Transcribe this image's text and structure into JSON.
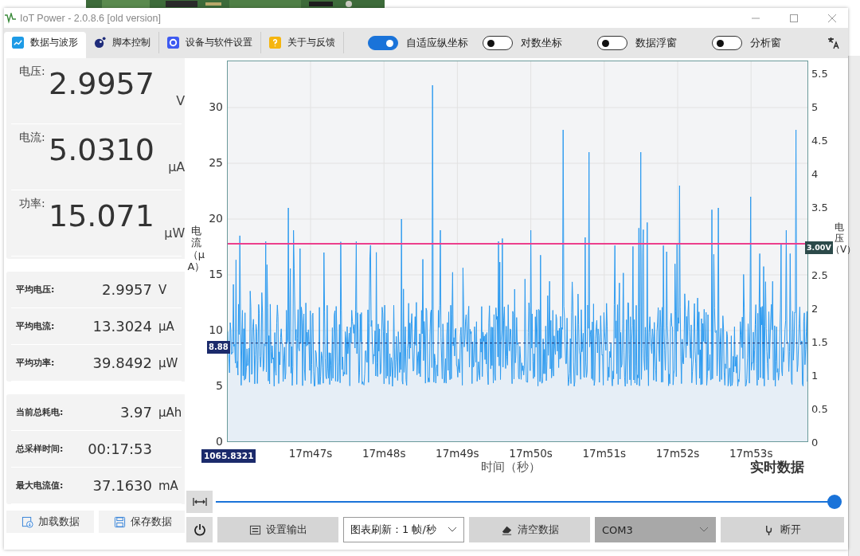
{
  "window": {
    "title": "IoT Power - 2.0.8.6  [old version]"
  },
  "tabs": [
    {
      "label": "数据与波形",
      "selected": true
    },
    {
      "label": "脚本控制",
      "selected": false
    },
    {
      "label": "设备与软件设置",
      "selected": false
    },
    {
      "label": "关于与反馈",
      "selected": false
    }
  ],
  "toggles": [
    {
      "label": "自适应纵坐标",
      "on": true
    },
    {
      "label": "对数坐标",
      "on": false
    },
    {
      "label": "数据浮窗",
      "on": false
    },
    {
      "label": "分析窗",
      "on": false
    }
  ],
  "readings": [
    {
      "label": "电压:",
      "value": "2.9957",
      "unit": "V"
    },
    {
      "label": "电流:",
      "value": "5.0310",
      "unit": "μA"
    },
    {
      "label": "功率:",
      "value": "15.071",
      "unit": "μW"
    }
  ],
  "averages": [
    {
      "label": "平均电压:",
      "value": "2.9957",
      "unit": "V"
    },
    {
      "label": "平均电流:",
      "value": "13.3024",
      "unit": "μA"
    },
    {
      "label": "平均功率:",
      "value": "39.8492",
      "unit": "μW"
    }
  ],
  "totals": [
    {
      "label": "当前总耗电:",
      "value": "3.97",
      "unit": "μAh"
    },
    {
      "label": "总采样时间:",
      "value": "00:17:53"
    },
    {
      "label": "最大电流值:",
      "value": "37.1630",
      "unit": "mA"
    }
  ],
  "panel_buttons": [
    "加载数据",
    "保存数据"
  ],
  "chart": {
    "y_ticks": [
      "30",
      "25",
      "20",
      "15",
      "10",
      "5",
      "0"
    ],
    "y2_ticks": [
      "5.5",
      "5",
      "4.5",
      "4",
      "3.5",
      "2.5",
      "2",
      "1.5",
      "1",
      "0.5",
      "0"
    ],
    "x_ticks": [
      "17m47s",
      "17m48s",
      "17m49s",
      "17m50s",
      "17m51s",
      "17m52s",
      "17m53s"
    ],
    "ylabel": "电流（μA）",
    "y2label": "电压（V）",
    "xlabel": "时间（秒）",
    "cursor_label": "1065.8321",
    "avg_label": "8.88",
    "threshold_label": "3.00V",
    "mode_label": "实时数据"
  },
  "slider": {
    "level": 1
  },
  "bottom_bar": [
    {
      "kind": "button",
      "label": "设置输出"
    },
    {
      "kind": "dropdown",
      "label": "图表刷新：1 帧/秒"
    },
    {
      "kind": "button",
      "label": "清空数据"
    },
    {
      "kind": "select",
      "label": "COM3"
    },
    {
      "kind": "button",
      "label": "断开"
    }
  ]
}
